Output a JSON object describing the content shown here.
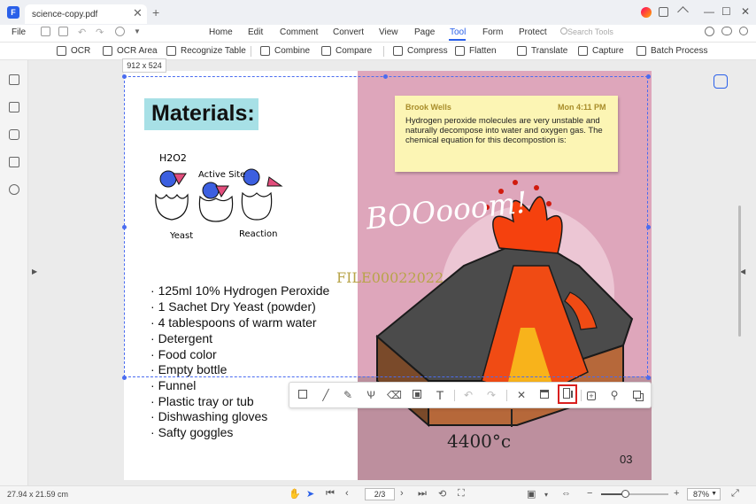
{
  "app": {
    "logo_letter": "F",
    "brand_color": "#2a60e9",
    "window_buttons": [
      "—",
      "☐",
      "✕"
    ]
  },
  "tab": {
    "title": "science-copy.pdf",
    "close": "✕",
    "add": "+"
  },
  "menubar": {
    "file": "File",
    "items": [
      "Home",
      "Edit",
      "Comment",
      "Convert",
      "View",
      "Page",
      "Tool",
      "Form",
      "Protect"
    ],
    "active": "Tool",
    "search_placeholder": "Search Tools"
  },
  "toolbar": {
    "ocr": "OCR",
    "ocr_area": "OCR Area",
    "recognize_table": "Recognize Table",
    "combine": "Combine",
    "compare": "Compare",
    "compress": "Compress",
    "flatten": "Flatten",
    "translate": "Translate",
    "capture": "Capture",
    "batch_process": "Batch Process"
  },
  "selection": {
    "size_label": "912 x 524",
    "color": "#4a6cf0"
  },
  "document": {
    "materials_title": "Materials:",
    "diagram_labels": {
      "h2o2": "H2O2",
      "active_site": "Active Site",
      "yeast": "Yeast",
      "reaction": "Reaction"
    },
    "materials": [
      "125ml 10% Hydrogen Peroxide",
      "1 Sachet Dry Yeast (powder)",
      "4 tablespoons of warm water",
      "Detergent",
      "Food color",
      "Empty bottle",
      "Funnel",
      "Plastic tray or tub",
      "Dishwashing gloves",
      "Safty goggles"
    ],
    "bullet": "·",
    "watermark": "FILE00022022",
    "note": {
      "author": "Brook Wells",
      "time": "Mon 4:11 PM",
      "body": "Hydrogen peroxide molecules are very unstable and naturally decompose into water and oxygen gas. The chemical equation for this decompostion is:"
    },
    "boom_text": "BOOooom!",
    "temperature": "4400°c",
    "page_number": "03"
  },
  "float_toolbar": {
    "tools": [
      "rectangle-icon",
      "line-icon",
      "pencil-icon",
      "highlighter-icon",
      "eraser-icon",
      "mosaic-icon",
      "text-icon",
      "undo-icon",
      "redo-icon",
      "close-icon",
      "save-icon",
      "copy-icon",
      "pin-icon",
      "pushpin-icon",
      "copy-to-clipboard-icon"
    ],
    "text_tool": "T",
    "close_tool": "✕",
    "highlight_color": "#d91f1f"
  },
  "statusbar": {
    "dimensions": "27.94 x 21.59 cm",
    "page": "2/3",
    "zoom": "87%",
    "zoom_out": "−",
    "zoom_in": "+",
    "zoom_level": 0.37
  }
}
